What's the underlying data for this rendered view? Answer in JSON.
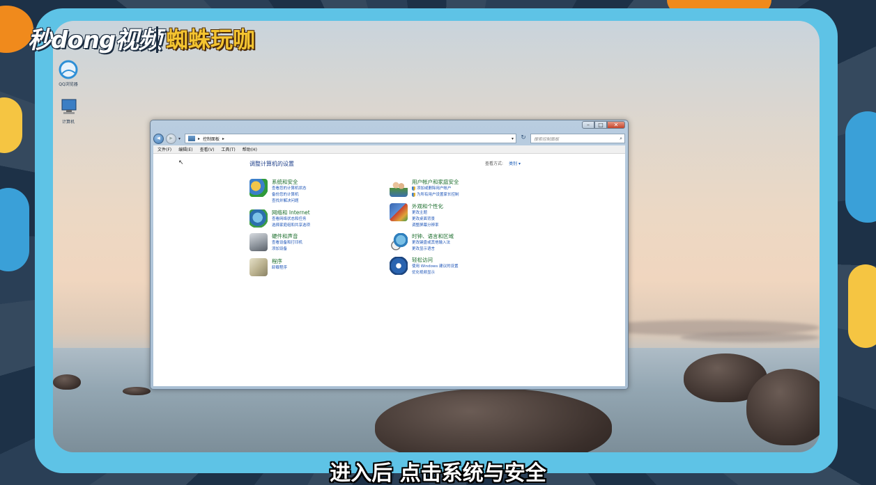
{
  "logo": {
    "brand": "秒dong视频",
    "partner": "蜘蛛玩咖"
  },
  "desktop_icons": [
    {
      "label": "QQ浏览器",
      "icon": "browser-icon"
    },
    {
      "label": "计算机",
      "icon": "computer-icon"
    }
  ],
  "window": {
    "controls": {
      "minimize": "–",
      "maximize": "□",
      "close": "✕"
    },
    "address": {
      "path": "控制面板",
      "separator": "▸"
    },
    "search_placeholder": "搜索控制面板",
    "menu": [
      "文件(F)",
      "编辑(E)",
      "查看(V)",
      "工具(T)",
      "帮助(H)"
    ],
    "content_title": "调整计算机的设置",
    "view_by_label": "查看方式:",
    "view_by_value": "类别 ▾",
    "categories": [
      {
        "title": "系统和安全",
        "icon": "system-security-icon",
        "links": [
          "查看您的计算机状态",
          "备份您的计算机",
          "查找并解决问题"
        ]
      },
      {
        "title": "网络和 Internet",
        "icon": "network-internet-icon",
        "links": [
          "查看网络状态和任务",
          "选择家庭组和共享选项"
        ]
      },
      {
        "title": "硬件和声音",
        "icon": "hardware-sound-icon",
        "links": [
          "查看设备和打印机",
          "添加设备"
        ]
      },
      {
        "title": "程序",
        "icon": "programs-icon",
        "links": [
          "卸载程序"
        ]
      },
      {
        "title": "用户帐户和家庭安全",
        "icon": "user-accounts-icon",
        "links": [
          "添加或删除用户帐户",
          "为所有用户设置家长控制"
        ]
      },
      {
        "title": "外观和个性化",
        "icon": "appearance-icon",
        "links": [
          "更改主题",
          "更改桌面背景",
          "调整屏幕分辨率"
        ]
      },
      {
        "title": "时钟、语言和区域",
        "icon": "clock-region-icon",
        "links": [
          "更改键盘或其他输入法",
          "更改显示语言"
        ]
      },
      {
        "title": "轻松访问",
        "icon": "ease-of-access-icon",
        "links": [
          "使用 Windows 建议的设置",
          "优化视频显示"
        ]
      }
    ]
  },
  "subtitle": "进入后 点击系统与安全",
  "colors": {
    "frame": "#5ec3e6",
    "link": "#1f56b8",
    "category_title": "#1b6d2c",
    "heading": "#1e3f8a"
  }
}
